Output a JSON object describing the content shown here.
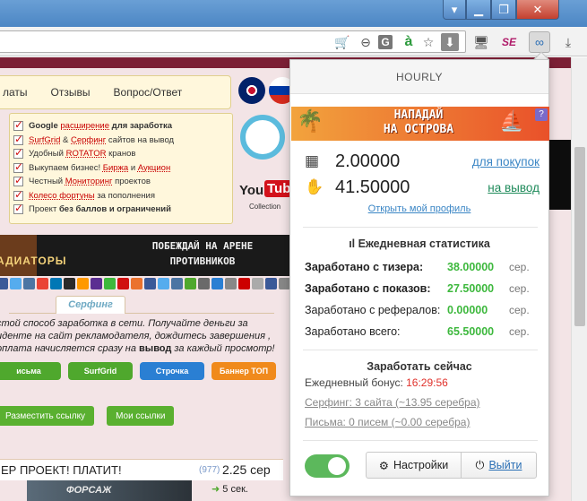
{
  "browser": {
    "toolbar_icons": [
      "cart-icon",
      "zoom-icon",
      "translate-icon",
      "a-icon",
      "star-icon",
      "download-box-icon",
      "monitor-icon",
      "se-icon",
      "extension-icon",
      "download-icon"
    ],
    "se_label": "SE",
    "translate_label": "G",
    "a_label": "à"
  },
  "page": {
    "nav": [
      "латы",
      "Отзывы",
      "Вопрос/Ответ"
    ],
    "features": [
      {
        "pre": "Google",
        "link": "расширение",
        "post": "для заработка",
        "bold": true
      },
      {
        "pre": "",
        "link": "SurfGrid",
        "mid": "&",
        "link2": "Серфинг",
        "post": "сайтов на вывод"
      },
      {
        "pre": "Удобный",
        "link": "ROTATOR",
        "post": "кранов"
      },
      {
        "pre": "Выкупаем бизнес!",
        "link": "Биржа",
        "mid": "и",
        "link2": "Аукцион",
        "post": ""
      },
      {
        "pre": "Честный",
        "link": "Мониторинг",
        "post": "проектов"
      },
      {
        "pre": "",
        "link": "Колесо фортуны",
        "post": "за пополнения"
      },
      {
        "pre": "Проект",
        "link": "",
        "post": "без баллов и ограничений",
        "boldpost": true
      }
    ],
    "youtube": {
      "you": "You",
      "tube": "Tube",
      "collection": "Collection"
    },
    "gladiators": {
      "left": "АДИАТОРЫ",
      "right_line1": "ПОБЕЖДАЙ НА АРЕНЕ",
      "right_line2": "ПРОТИВНИКОВ"
    },
    "surf_tab": "Серфинг",
    "description_pre": "стой способ заработка в сети. Получайте деньги за иденте на сайт рекламодателя, дождитесь завершения , оплата начисляется сразу на ",
    "description_bold": "вывод",
    "description_post": " за каждый просмотр!",
    "pills": [
      "исьма",
      "SurfGrid",
      "Строчка",
      "Баннер ТОП"
    ],
    "actions": [
      "Разместить ссылку",
      "Мои ссылки"
    ],
    "project": {
      "title": "ЕР ПРОЕКТ! ПЛАТИТ!",
      "count": "(977)",
      "price": "2.25 сер",
      "movie": "ФОРСАЖ",
      "timer": "5 сек."
    }
  },
  "popup": {
    "header": "HOURLY",
    "banner": {
      "line1": "НАПАДАЙ",
      "line2": "НА ОСТРОВА",
      "badge": "?"
    },
    "balances": [
      {
        "icon": "abacus-icon",
        "value": "2.00000",
        "link": "для покупок"
      },
      {
        "icon": "money-hand-icon",
        "value": "41.50000",
        "link": "на вывод"
      }
    ],
    "profile_link": "Открыть мой профиль",
    "stats_title": "Ежедневная статистика",
    "stats": [
      {
        "label": "Заработано с тизера:",
        "value": "38.00000",
        "unit": "сер.",
        "bold": true
      },
      {
        "label": "Заработано с показов:",
        "value": "27.50000",
        "unit": "сер.",
        "bold": true
      },
      {
        "label": "Заработано с рефералов:",
        "value": "0.00000",
        "unit": "сер.",
        "bold": false
      },
      {
        "label": "Заработано всего:",
        "value": "65.50000",
        "unit": "сер.",
        "bold": false
      }
    ],
    "earn_title": "Заработать сейчас",
    "bonus_label": "Ежедневный бонус:",
    "bonus_timer": "16:29:56",
    "surfing_link": "Серфинг: 3 сайта (~13.95 серебра)",
    "letters_link": "Письма: 0 писем (~0.00 серебра)",
    "settings_label": "Настройки",
    "exit_label": "Выйти",
    "toggle_on": true
  }
}
